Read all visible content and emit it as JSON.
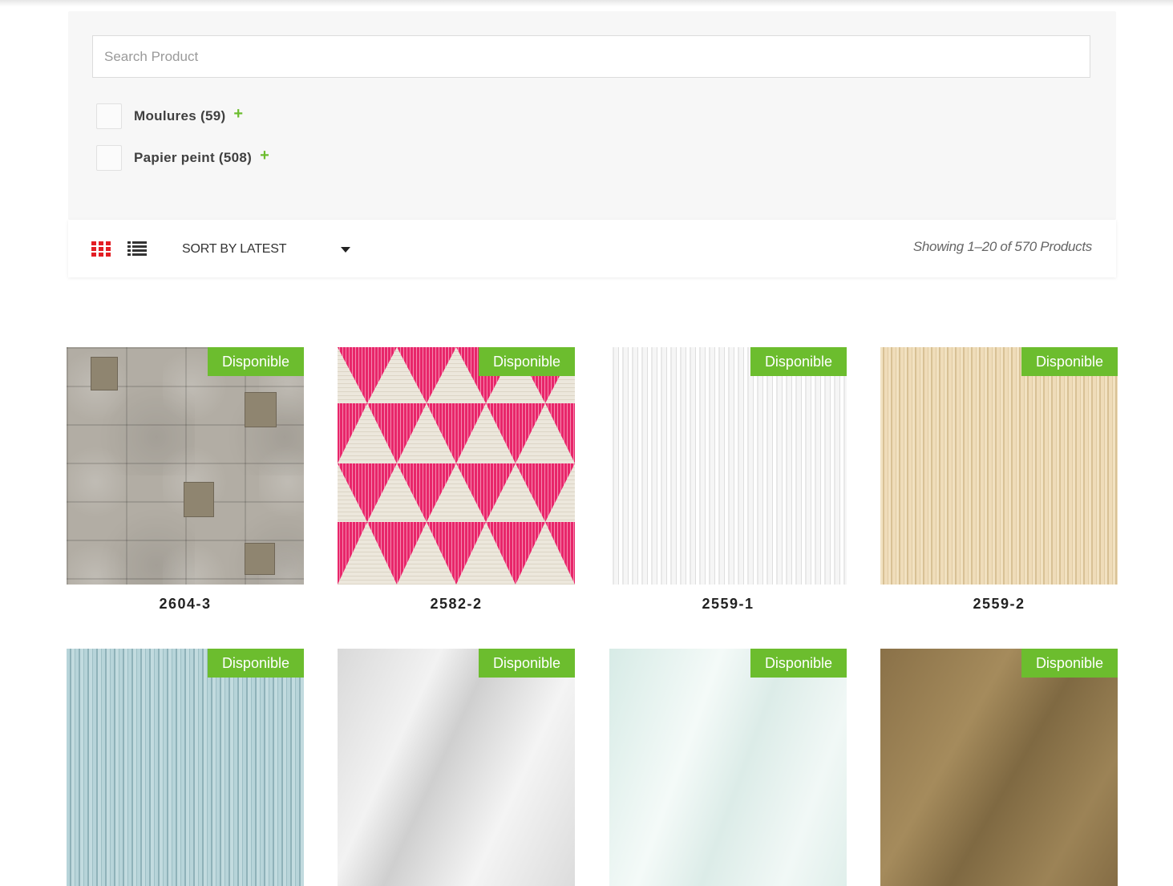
{
  "search": {
    "placeholder": "Search Product",
    "value": ""
  },
  "filters": [
    {
      "label": "Moulures (59)",
      "checked": false
    },
    {
      "label": "Papier peint (508)",
      "checked": false
    }
  ],
  "toolbar": {
    "view_grid_icon": "grid-view-icon",
    "view_list_icon": "list-view-icon",
    "sort_label": "SORT BY LATEST",
    "result_count": "Showing 1–20 of 570 Products"
  },
  "colors": {
    "accent": "#e31e24",
    "badge": "#6cbd2e"
  },
  "products": [
    {
      "title": "2604-3",
      "badge": "Disponible"
    },
    {
      "title": "2582-2",
      "badge": "Disponible"
    },
    {
      "title": "2559-1",
      "badge": "Disponible"
    },
    {
      "title": "2559-2",
      "badge": "Disponible"
    },
    {
      "title": "",
      "badge": "Disponible"
    },
    {
      "title": "",
      "badge": "Disponible"
    },
    {
      "title": "",
      "badge": "Disponible"
    },
    {
      "title": "",
      "badge": "Disponible"
    }
  ]
}
